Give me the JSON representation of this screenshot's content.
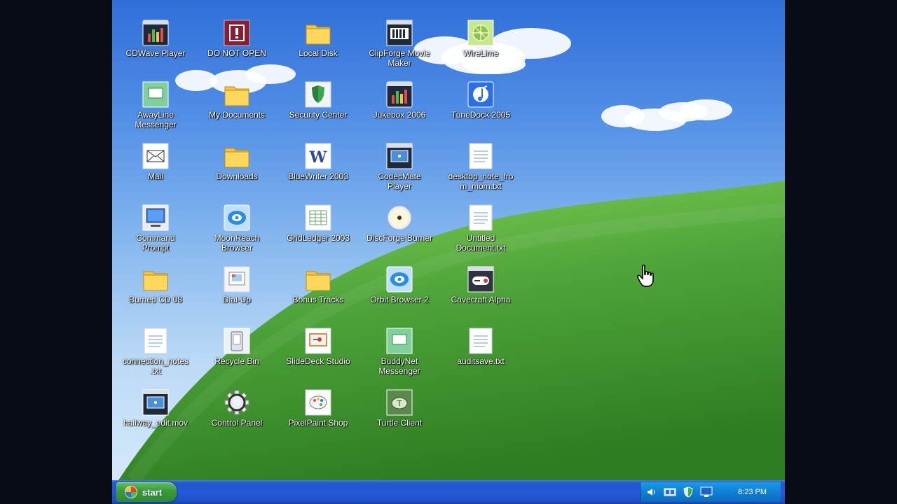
{
  "desktop": {
    "icons": [
      {
        "label": "CDWave Player",
        "icon": "media-player-icon"
      },
      {
        "label": "DO NOT OPEN",
        "icon": "warning-program-icon"
      },
      {
        "label": "Local Disk",
        "icon": "folder-icon"
      },
      {
        "label": "ClipForge Movie Maker",
        "icon": "movie-maker-icon"
      },
      {
        "label": "WireLime",
        "icon": "wirelime-icon"
      },
      {
        "label": "AwayLine Messenger",
        "icon": "messenger-icon"
      },
      {
        "label": "My Documents",
        "icon": "folder-icon"
      },
      {
        "label": "Security Center",
        "icon": "shield-icon"
      },
      {
        "label": "Jukebox 2006",
        "icon": "media-player-icon"
      },
      {
        "label": "TuneDock 2005",
        "icon": "music-icon"
      },
      {
        "label": "Mail",
        "icon": "mail-icon"
      },
      {
        "label": "Downloads",
        "icon": "folder-icon"
      },
      {
        "label": "BlueWriter 2003",
        "icon": "word-processor-icon"
      },
      {
        "label": "CodecMate Player",
        "icon": "video-player-icon"
      },
      {
        "label": "desktop_note_from_mom.txt",
        "icon": "text-file-icon"
      },
      {
        "label": "Command Prompt",
        "icon": "terminal-icon"
      },
      {
        "label": "Downloads",
        "icon": "folder-icon",
        "skip": true
      },
      {
        "label": "MoonReach Browser",
        "icon": "browser-icon"
      },
      {
        "label": "GridLedger 2003",
        "icon": "spreadsheet-icon"
      },
      {
        "label": "DiscForge Burner",
        "icon": "disc-icon"
      },
      {
        "label": "Untitled Document.txt",
        "icon": "text-file-icon"
      },
      {
        "label": "Burned CD 08",
        "icon": "folder-icon"
      },
      {
        "label": "Dial-Up",
        "icon": "dial-up-icon"
      },
      {
        "label": "Bonus Tracks",
        "icon": "folder-icon"
      },
      {
        "label": "Orbit Browser 2",
        "icon": "browser-icon"
      },
      {
        "label": "Cavecraft Alpha",
        "icon": "game-icon"
      },
      {
        "label": "connection_notes.txt",
        "icon": "text-file-icon"
      },
      {
        "label": "Recycle Bin",
        "icon": "recycle-bin-icon"
      },
      {
        "label": "SlideDeck Studio",
        "icon": "presentation-icon"
      },
      {
        "label": "BuddyNet Messenger",
        "icon": "messenger-icon"
      },
      {
        "label": "auditsave.txt",
        "icon": "text-file-icon"
      },
      {
        "label": "hallway_edit.mov",
        "icon": "video-file-icon"
      },
      {
        "label": "Control Panel",
        "icon": "control-panel-icon"
      },
      {
        "label": "PixelPaint Shop",
        "icon": "paint-icon"
      },
      {
        "label": "Turtle Client",
        "icon": "turtle-icon"
      }
    ]
  },
  "taskbar": {
    "start_label": "start",
    "clock": "8:23 PM",
    "tray_icons": [
      "volume-icon",
      "network-icon",
      "security-shield-icon",
      "display-icon"
    ]
  },
  "colors": {
    "sky_top": "#2f6fd8",
    "grass": "#3f9a2c",
    "taskbar": "#245ad6",
    "start_button": "#3a9a3a",
    "tray": "#0f7fd4"
  }
}
